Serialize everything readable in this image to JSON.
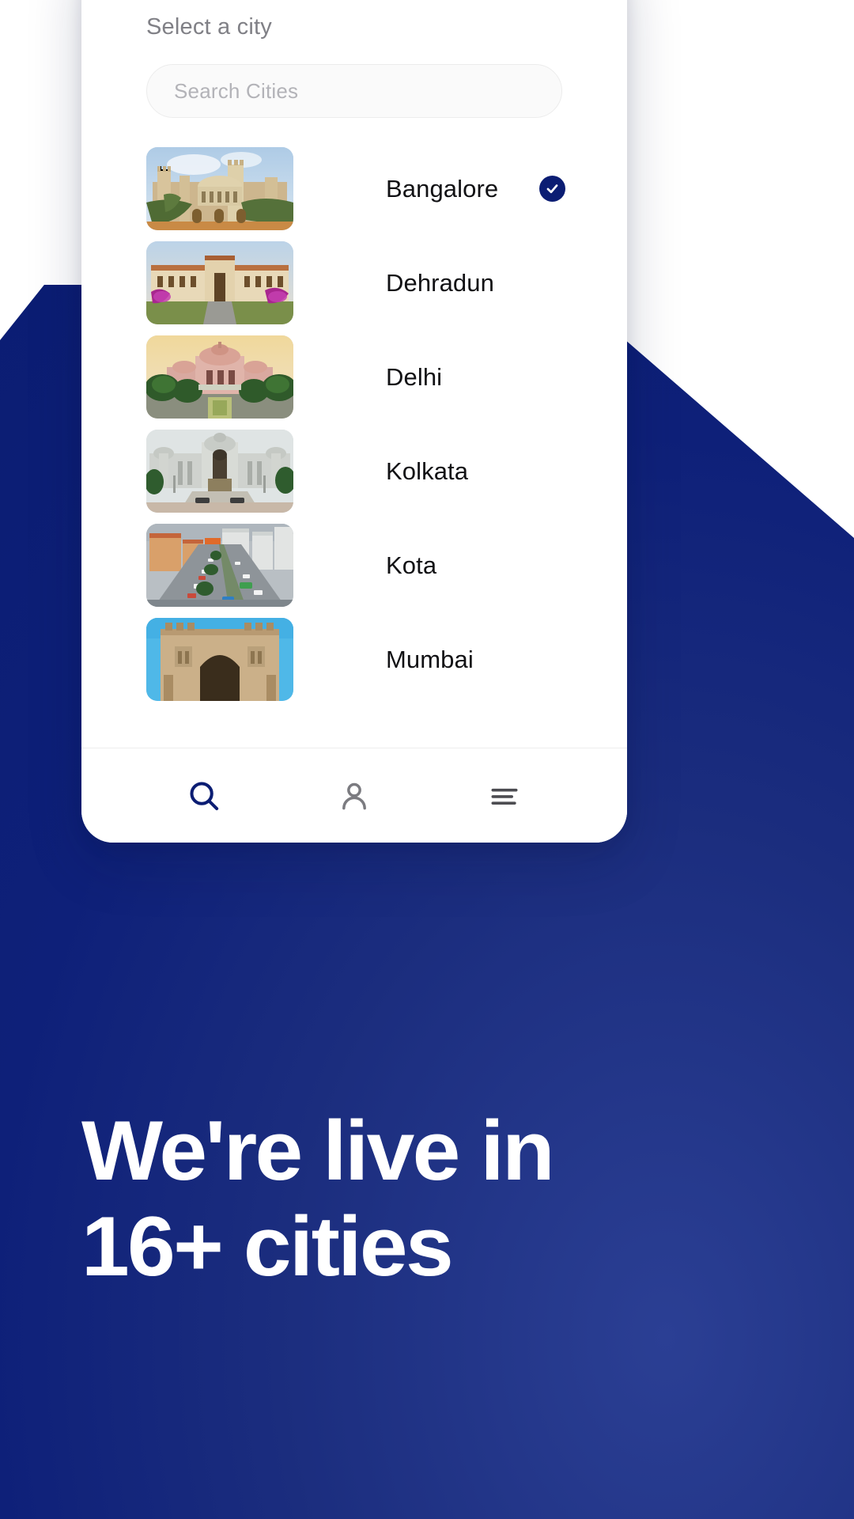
{
  "theme": {
    "navy": "#0b1d73",
    "navy_gradient_light": "#2b3f94",
    "card_bg": "#ffffff",
    "title_gray": "#808086",
    "placeholder_gray": "#b3b3b8",
    "city_text": "#111114",
    "nav_active": "#0b1d73",
    "nav_inactive": "#7b7b80"
  },
  "screen": {
    "title": "Select a city"
  },
  "search": {
    "name": "search-cities-input",
    "value": "",
    "placeholder": "Search Cities"
  },
  "cities": [
    {
      "name": "Bangalore",
      "landmark": "bangalore-palace",
      "selected": true
    },
    {
      "name": "Dehradun",
      "landmark": "forest-research-institute",
      "selected": false
    },
    {
      "name": "Delhi",
      "landmark": "akshardham-temple",
      "selected": false
    },
    {
      "name": "Kolkata",
      "landmark": "victoria-memorial",
      "selected": false
    },
    {
      "name": "Kota",
      "landmark": "city-street-aerial",
      "selected": false
    },
    {
      "name": "Mumbai",
      "landmark": "gateway-of-india",
      "selected": false
    }
  ],
  "bottom_nav": [
    {
      "icon": "search-icon",
      "active": true
    },
    {
      "icon": "person-icon",
      "active": false
    },
    {
      "icon": "hamburger-menu-icon",
      "active": false
    }
  ],
  "headline": {
    "line1": "We're live in",
    "line2": "16+ cities"
  }
}
